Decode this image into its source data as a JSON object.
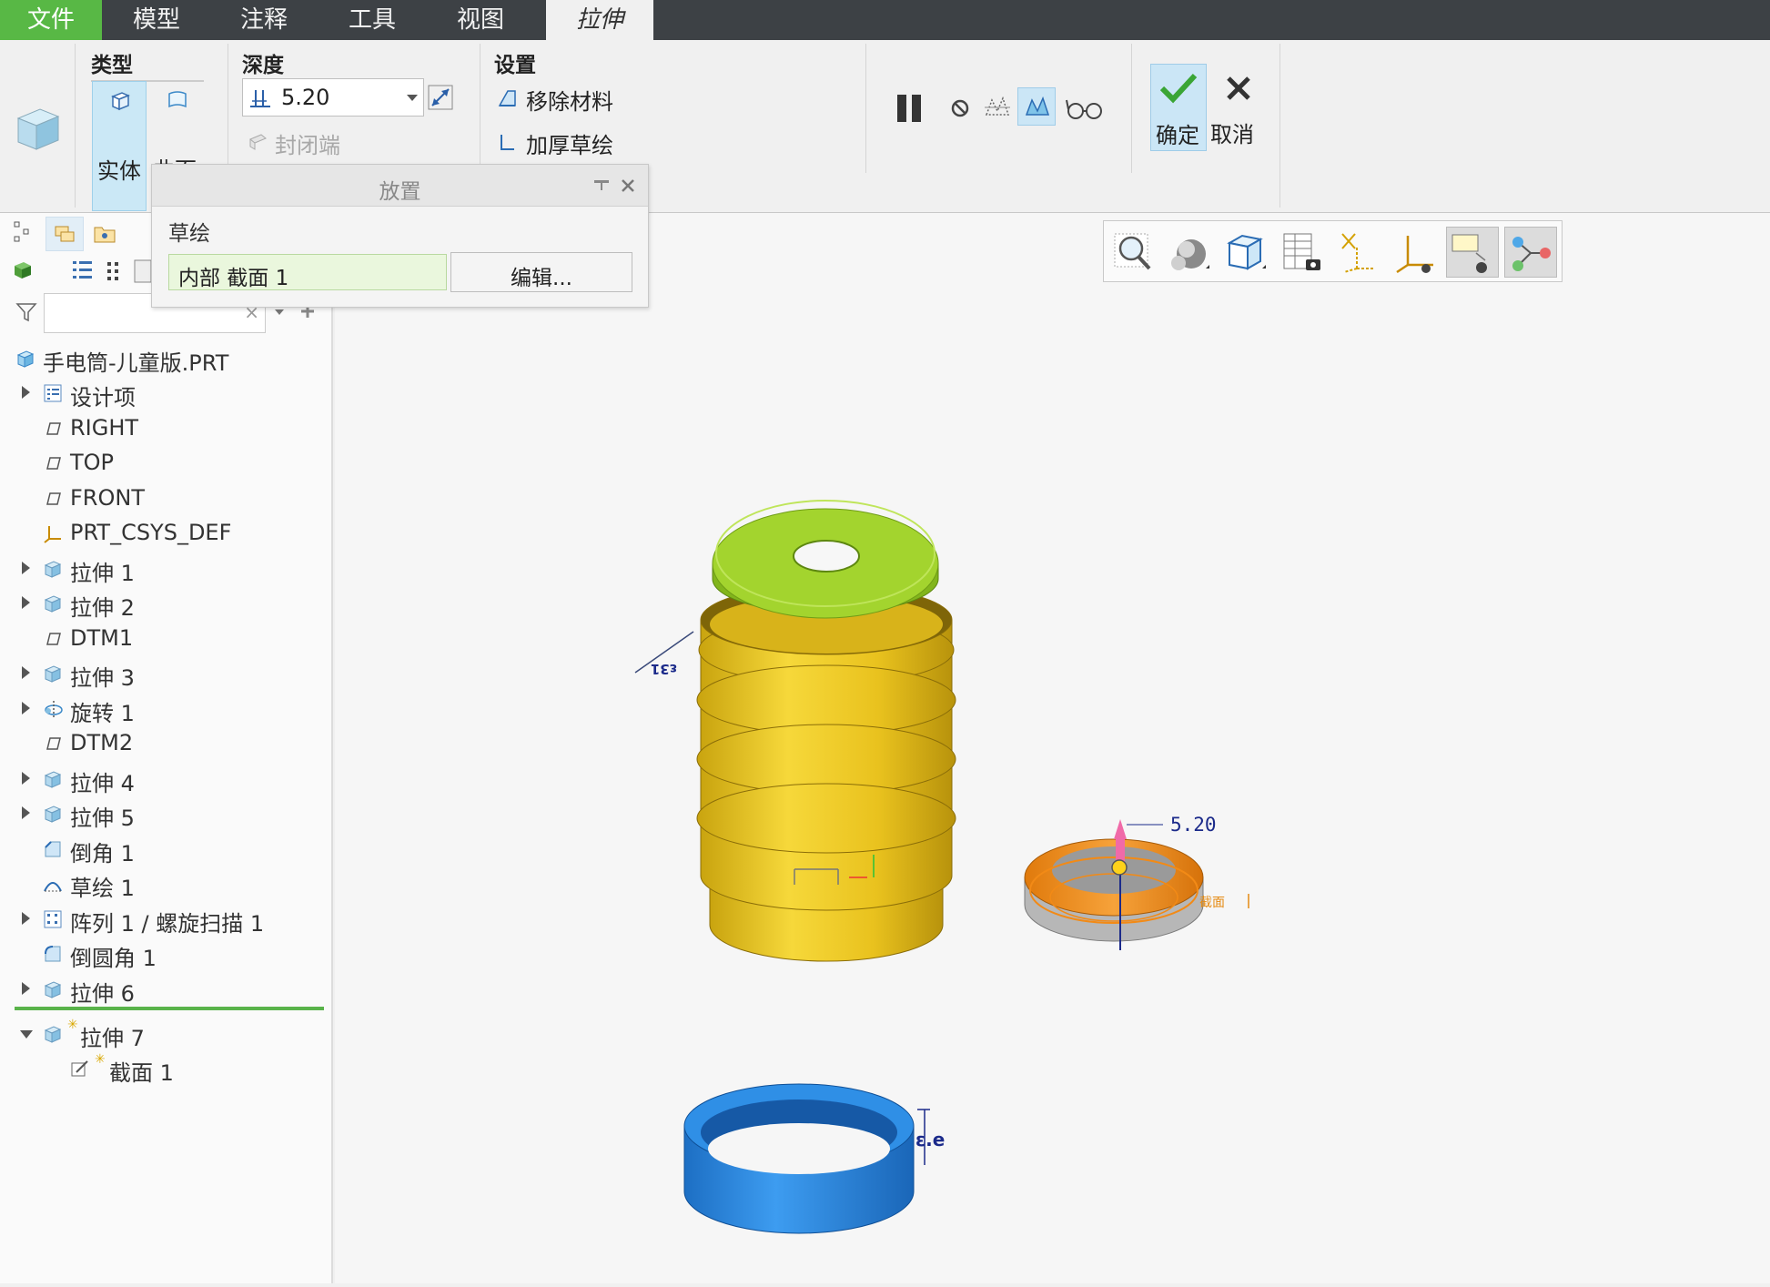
{
  "menu": {
    "tabs": [
      {
        "label": "文件"
      },
      {
        "label": "模型"
      },
      {
        "label": "注释"
      },
      {
        "label": "工具"
      },
      {
        "label": "视图"
      },
      {
        "label": "拉伸"
      }
    ]
  },
  "ribbon": {
    "type_group": {
      "title": "类型",
      "solid": "实体",
      "surface": "曲面"
    },
    "depth_group": {
      "title": "深度",
      "value": "5.20",
      "capped_ends": "封闭端"
    },
    "settings_group": {
      "title": "设置",
      "remove_material": "移除材料",
      "thicken_sketch": "加厚草绘"
    },
    "ok_label": "确定",
    "cancel_label": "取消"
  },
  "placement_panel": {
    "title": "放置",
    "sketch_label": "草绘",
    "sketch_value": "内部 截面 1",
    "edit_button": "编辑..."
  },
  "model_tree": {
    "root": "手电筒-儿童版.PRT",
    "items": [
      {
        "label": "设计项",
        "icon": "design-items-icon",
        "expandable": true
      },
      {
        "label": "RIGHT",
        "icon": "datum-plane-icon",
        "expandable": false
      },
      {
        "label": "TOP",
        "icon": "datum-plane-icon",
        "expandable": false
      },
      {
        "label": "FRONT",
        "icon": "datum-plane-icon",
        "expandable": false
      },
      {
        "label": "PRT_CSYS_DEF",
        "icon": "csys-icon",
        "expandable": false
      },
      {
        "label": "拉伸 1",
        "icon": "extrude-icon",
        "expandable": true
      },
      {
        "label": "拉伸 2",
        "icon": "extrude-icon",
        "expandable": true
      },
      {
        "label": "DTM1",
        "icon": "datum-plane-icon",
        "expandable": false
      },
      {
        "label": "拉伸 3",
        "icon": "extrude-icon",
        "expandable": true
      },
      {
        "label": "旋转 1",
        "icon": "revolve-icon",
        "expandable": true
      },
      {
        "label": "DTM2",
        "icon": "datum-plane-icon",
        "expandable": false
      },
      {
        "label": "拉伸 4",
        "icon": "extrude-icon",
        "expandable": true
      },
      {
        "label": "拉伸 5",
        "icon": "extrude-icon",
        "expandable": true
      },
      {
        "label": "倒角 1",
        "icon": "chamfer-icon",
        "expandable": false
      },
      {
        "label": "草绘 1",
        "icon": "sketch-icon",
        "expandable": false
      },
      {
        "label": "阵列 1 / 螺旋扫描 1",
        "icon": "pattern-icon",
        "expandable": true
      },
      {
        "label": "倒圆角 1",
        "icon": "round-icon",
        "expandable": false
      },
      {
        "label": "拉伸 6",
        "icon": "extrude-icon",
        "expandable": true
      }
    ],
    "active_feature": "拉伸 7",
    "active_child": "截面 1"
  },
  "viewport": {
    "depth_dimension": "5.20",
    "section_tag": "截面",
    "dim_text_body": "ε31",
    "dim_text_ring": "ε.e"
  },
  "colors": {
    "accent_green": "#58b845",
    "lid_green": "#9bd12b",
    "body_yellow": "#e8c21e",
    "ring_orange": "#f08a12",
    "ring_blue": "#2e8ee0"
  }
}
